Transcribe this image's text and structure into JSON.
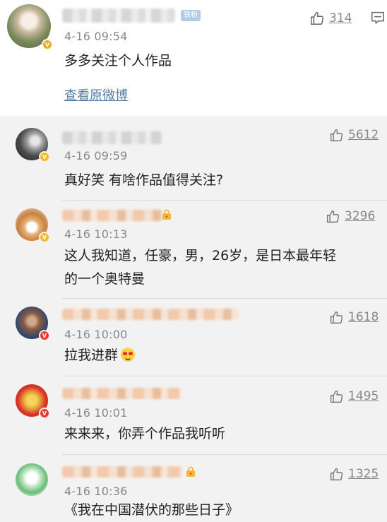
{
  "original_post": {
    "time": "4-16 09:54",
    "fan_badge": "铁粉",
    "like_count": "314",
    "content": "多多关注个人作品",
    "view_original": "查看原微博"
  },
  "comments": [
    {
      "time": "4-16 09:59",
      "like_count": "5612",
      "content": "真好笑 有啥作品值得关注?"
    },
    {
      "time": "4-16 10:13",
      "like_count": "3296",
      "content_line1": "这人我知道，任豪，男，26岁，是日本最年轻",
      "content_line2": "的一个奥特曼"
    },
    {
      "time": "4-16 10:00",
      "like_count": "1618",
      "content": "拉我进群"
    },
    {
      "time": "4-16 10:01",
      "like_count": "1495",
      "content": "来来来，你弄个作品我听听"
    },
    {
      "time": "4-16 10:36",
      "like_count": "1325",
      "content": "《我在中国潜伏的那些日子》"
    }
  ],
  "colors": {
    "link": "#567ca6",
    "fan_badge": "#aecdea",
    "verified_gold": "#f5a623",
    "verified_red": "#e8382b"
  },
  "icons": [
    "thumbs-up-icon",
    "comment-menu-icon",
    "verified-badge-icon",
    "lock-icon"
  ]
}
